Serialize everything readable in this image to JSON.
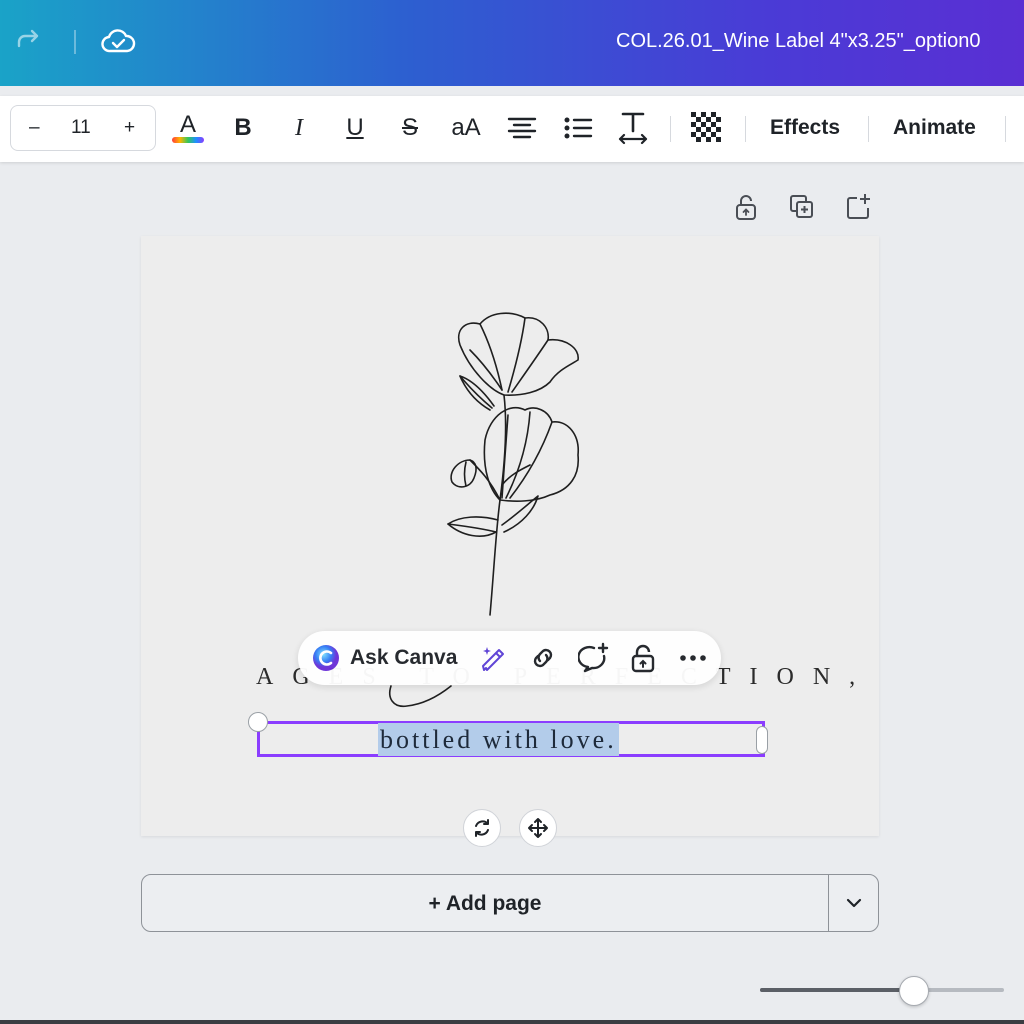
{
  "header": {
    "doc_title": "COL.26.01_Wine Label 4\"x3.25\"_option0",
    "icons": [
      "redo-icon",
      "cloud-saved-icon"
    ]
  },
  "toolbar": {
    "font_size": "11",
    "decrease_label": "–",
    "increase_label": "+",
    "text_color_letter": "A",
    "bold_label": "B",
    "italic_label": "I",
    "underline_label": "U",
    "strike_label": "S",
    "case_label": "aA",
    "effects_label": "Effects",
    "animate_label": "Animate"
  },
  "canvas": {
    "line1_text": "AGES TO PERFECTION,",
    "line2_text": "bottled with love."
  },
  "context_menu": {
    "ask_label": "Ask Canva"
  },
  "add_page": {
    "label": "+ Add page"
  },
  "zoom": {
    "level": 0.63
  },
  "colors": {
    "selection": "#8b3dff",
    "highlight": "#b3ccea",
    "header_start": "#1aa3c8",
    "header_end": "#5a2fd3"
  }
}
